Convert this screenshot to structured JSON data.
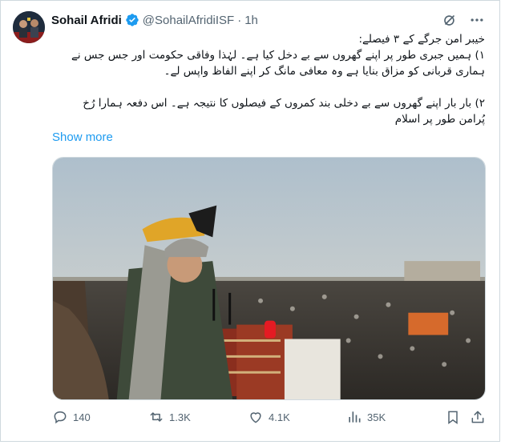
{
  "author": {
    "name": "Sohail Afridi",
    "handle": "@SohailAfridiISF",
    "separator": "·",
    "time": "1h"
  },
  "tweet": {
    "lines": [
      "خیبر امن جرگے کے ۳ فیصلے:",
      "۱) ہمیں جبری طور پر اپنے گھروں سے بے دخل کیا ہے۔ لہٰذا وفاقی حکومت اور جس جس نے",
      "ہماری قربانی کو مزاق بنایا ہے وہ معافی مانگ کر اپنے الفاظ واپس لے۔",
      "۲) بار بار اپنے گھروں سے بے دخلی بند کمروں کے فیصلوں کا نتیجہ ہے۔ اس دفعہ ہمارا رُخ",
      "پُرامن طور پر اسلام"
    ],
    "show_more": "Show more"
  },
  "stats": {
    "replies": "140",
    "reposts": "1.3K",
    "likes": "4.1K",
    "views": "35K"
  },
  "icons": {
    "verified": "verified-badge-icon",
    "grok": "grok-icon",
    "more": "more-icon",
    "reply": "reply-icon",
    "repost": "repost-icon",
    "like": "like-icon",
    "views": "views-icon",
    "bookmark": "bookmark-icon",
    "share": "share-icon"
  },
  "colors": {
    "link": "#1d9bf0",
    "verified": "#1d9bf0",
    "muted": "#536471",
    "text": "#0f1419"
  }
}
